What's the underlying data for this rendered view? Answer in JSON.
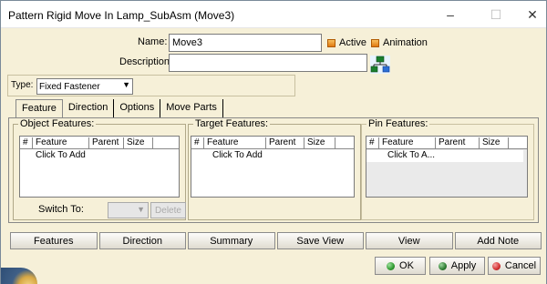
{
  "window": {
    "title": "Pattern Rigid Move In Lamp_SubAsm (Move3)",
    "minimize_glyph": "–",
    "maximize_glyph": "☐",
    "close_glyph": "✕"
  },
  "form": {
    "name_label": "Name:",
    "name_value": "Move3",
    "description_label": "Description:",
    "description_value": "",
    "active_label": "Active",
    "animation_label": "Animation",
    "type_label": "Type:",
    "type_value": "Fixed Fastener"
  },
  "tabs": [
    {
      "label": "Feature",
      "active": true
    },
    {
      "label": "Direction",
      "active": false
    },
    {
      "label": "Options",
      "active": false
    },
    {
      "label": "Move Parts",
      "active": false
    }
  ],
  "groups": {
    "object": {
      "title": "Object Features:",
      "columns": [
        "#",
        "Feature",
        "Parent",
        "Size"
      ],
      "row": "Click To Add"
    },
    "target": {
      "title": "Target Features:",
      "columns": [
        "#",
        "Feature",
        "Parent",
        "Size"
      ],
      "row": "Click To Add"
    },
    "pin": {
      "title": "Pin Features:",
      "columns": [
        "#",
        "Feature",
        "Parent",
        "Size"
      ],
      "row": "Click To A..."
    }
  },
  "switch": {
    "label": "Switch To:",
    "delete_label": "Delete"
  },
  "bottom_buttons": [
    "Features",
    "Direction",
    "Summary",
    "Save View",
    "View",
    "Add Note"
  ],
  "dialog_buttons": {
    "ok": {
      "label": "OK",
      "color": "#2e9a2e"
    },
    "apply": {
      "label": "Apply",
      "color": "#2e7d32"
    },
    "cancel": {
      "label": "Cancel",
      "color": "#d32f2f"
    }
  },
  "colors": {
    "background": "#f6f0d8",
    "checkbox_accent": "#e07a10"
  },
  "icons": {
    "tree": "assembly-tree-icon"
  }
}
